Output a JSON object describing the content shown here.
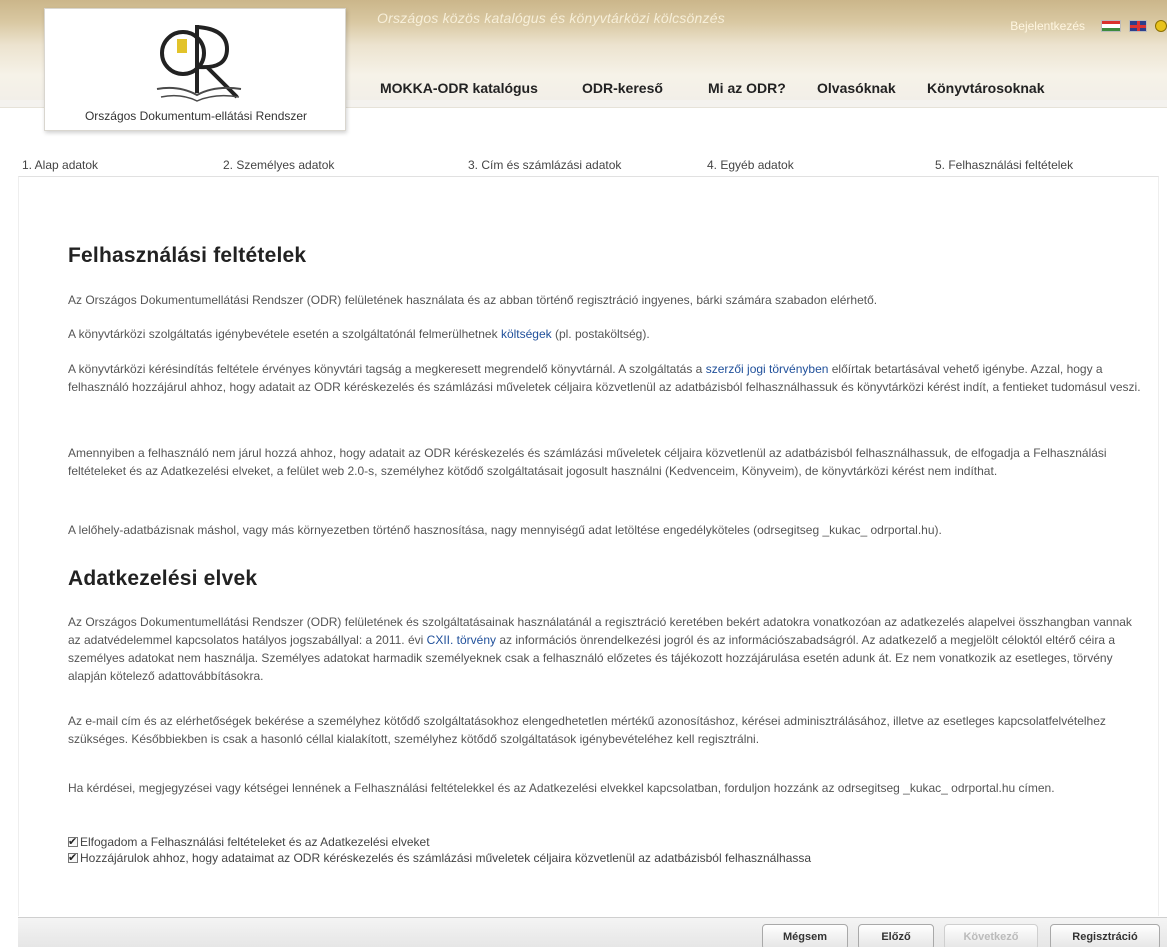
{
  "header": {
    "tagline": "Országos közös katalógus és könyvtárközi kölcsönzés",
    "login": "Bejelentkezés",
    "logo_caption": "Országos Dokumentum-ellátási Rendszer",
    "logo_text": "ODR",
    "icons": [
      "flag-hu-icon",
      "flag-uk-icon",
      "accessibility-icon"
    ],
    "colors": {
      "band": "#cbb68a",
      "tagline": "#f7efd9"
    }
  },
  "nav": {
    "items": [
      "MOKKA-ODR katalógus",
      "ODR-kereső",
      "Mi az ODR?",
      "Olvasóknak",
      "Könyvtárosoknak"
    ]
  },
  "steps": [
    "1. Alap adatok",
    "2. Személyes adatok",
    "3. Cím és számlázási adatok",
    "4. Egyéb adatok",
    "5. Felhasználási feltételek"
  ],
  "terms": {
    "title": "Felhasználási feltételek",
    "p1": "Az Országos Dokumentumellátási Rendszer (ODR) felületének használata és az abban történő regisztráció ingyenes, bárki számára szabadon elérhető.",
    "p2_before": "A könyvtárközi szolgáltatás igénybevétele esetén a szolgáltatónál felmerülhetnek ",
    "p2_link": "költségek",
    "p2_after": " (pl. postaköltség).",
    "p3_before": "A könyvtárközi kérésindítás feltétele érvényes könyvtári tagság a megkeresett megrendelő könyvtárnál. A szolgáltatás a ",
    "p3_link": "szerzői jogi törvényben",
    "p3_after": " előírtak betartásával vehető igénybe. Azzal, hogy a felhasználó hozzájárul ahhoz, hogy adatait az ODR kéréskezelés és számlázási műveletek céljaira közvetlenül az adatbázisból felhasználhassuk és könyvtárközi kérést indít, a fentieket tudomásul veszi.",
    "p4": "Amennyiben a felhasználó nem járul hozzá ahhoz, hogy adatait az ODR kéréskezelés és számlázási műveletek céljaira közvetlenül az adatbázisból felhasználhassuk, de elfogadja a Felhasználási feltételeket és az Adatkezelési elveket, a felület web 2.0-s, személyhez kötődő szolgáltatásait jogosult használni (Kedvenceim, Könyveim), de könyvtárközi kérést nem indíthat.",
    "p5": "A lelőhely-adatbázisnak máshol, vagy más környezetben történő hasznosítása, nagy mennyiségű adat letöltése engedélyköteles (odrsegitseg _kukac_ odrportal.hu)."
  },
  "privacy": {
    "title": "Adatkezelési elvek",
    "p1_before": "Az Országos Dokumentumellátási Rendszer (ODR) felületének és szolgáltatásainak használatánál a regisztráció keretében bekért adatokra vonatkozóan az adatkezelés alapelvei összhangban vannak az adatvédelemmel kapcsolatos hatályos jogszabállyal: a 2011. évi ",
    "p1_link": "CXII. törvény",
    "p1_after": " az információs önrendelkezési jogról és az információszabadságról. Az adatkezelő a megjelölt céloktól eltérő céira a személyes adatokat nem használja. Személyes adatokat harmadik személyeknek csak a felhasználó előzetes és tájékozott hozzájárulása esetén adunk át. Ez nem vonatkozik az esetleges, törvény alapján kötelező adattovábbításokra.",
    "p2": "Az e-mail cím és az elérhetőségek bekérése a személyhez kötődő szolgáltatásokhoz elengedhetetlen mértékű azonosításhoz, kérései adminisztrálásához, illetve az esetleges kapcsolatfelvételhez szükséges. Későbbiekben is csak a hasonló céllal kialakított, személyhez kötődő szolgáltatások igénybevételéhez kell regisztrálni.",
    "p3": "Ha kérdései, megjegyzései vagy kétségei lennének a Felhasználási feltételekkel és az Adatkezelési elvekkel kapcsolatban, forduljon hozzánk az odrsegitseg _kukac_ odrportal.hu címen."
  },
  "checkboxes": [
    {
      "label": "Elfogadom a Felhasználási feltételeket és az Adatkezelési elveket",
      "checked": true
    },
    {
      "label": "Hozzájárulok ahhoz, hogy adataimat az ODR kéréskezelés és számlázási műveletek céljaira közvetlenül az adatbázisból felhasználhassa",
      "checked": true
    }
  ],
  "buttons": {
    "cancel": "Mégsem",
    "prev": "Előző",
    "next": "Következő",
    "register": "Regisztráció",
    "next_disabled": true
  }
}
